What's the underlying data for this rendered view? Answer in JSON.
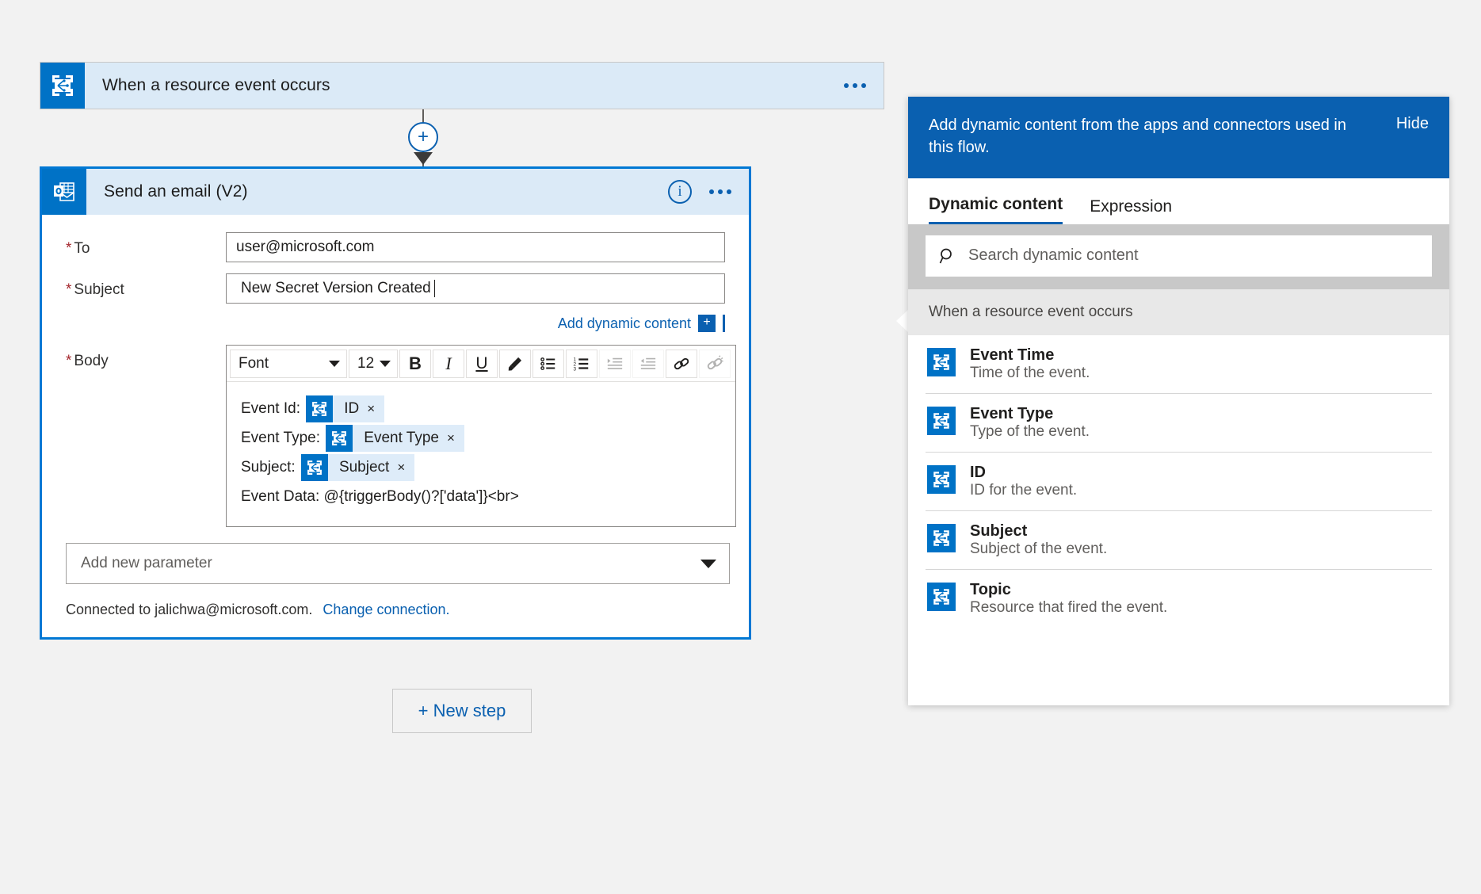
{
  "flow": {
    "trigger": {
      "title": "When a resource event occurs",
      "icon": "event-grid-icon",
      "more_label": "..."
    },
    "connector": {
      "add_label": "+"
    },
    "action": {
      "title": "Send an email (V2)",
      "icon": "outlook-icon",
      "info_label": "i",
      "more_label": "...",
      "fields": {
        "to": {
          "label": "To",
          "required": true,
          "value": "user@microsoft.com"
        },
        "subject": {
          "label": "Subject",
          "required": true,
          "value": "New Secret Version Created"
        },
        "body": {
          "label": "Body",
          "required": true
        }
      },
      "add_dynamic_content": {
        "link": "Add dynamic content",
        "plus": "+"
      },
      "editor": {
        "font_value": "Font",
        "size_value": "12",
        "buttons": [
          {
            "name": "bold-button",
            "glyph": "B"
          },
          {
            "name": "italic-button",
            "glyph": "I"
          },
          {
            "name": "underline-button",
            "glyph": "U"
          },
          {
            "name": "highlight-button",
            "glyph": "highlighter-icon"
          },
          {
            "name": "bullet-list-button",
            "glyph": "bullet-list-icon"
          },
          {
            "name": "numbered-list-button",
            "glyph": "numbered-list-icon"
          },
          {
            "name": "indent-button",
            "glyph": "indent-icon"
          },
          {
            "name": "outdent-button",
            "glyph": "outdent-icon"
          },
          {
            "name": "link-button",
            "glyph": "link-icon"
          },
          {
            "name": "unlink-button",
            "glyph": "unlink-icon"
          }
        ],
        "lines": [
          {
            "text": "Event Id: ",
            "token": "ID"
          },
          {
            "text": "Event Type: ",
            "token": "Event Type"
          },
          {
            "text": "Subject: ",
            "token": "Subject"
          },
          {
            "text": "Event Data: @{triggerBody()?['data']}<br>",
            "token": null
          }
        ],
        "token_remove_label": "×"
      },
      "add_parameter": "Add new parameter",
      "connection_text": "Connected to jalichwa@microsoft.com.",
      "change_connection": "Change connection."
    },
    "new_step": "+ New step"
  },
  "flyout": {
    "header_text": "Add dynamic content from the apps and connectors used in this flow.",
    "hide_label": "Hide",
    "tabs": [
      {
        "label": "Dynamic content",
        "active": true
      },
      {
        "label": "Expression",
        "active": false
      }
    ],
    "search": {
      "placeholder": "Search dynamic content",
      "value": ""
    },
    "group_title": "When a resource event occurs",
    "items": [
      {
        "name": "Event Time",
        "desc": "Time of the event.",
        "icon": "event-grid-icon"
      },
      {
        "name": "Event Type",
        "desc": "Type of the event.",
        "icon": "event-grid-icon"
      },
      {
        "name": "ID",
        "desc": "ID for the event.",
        "icon": "event-grid-icon"
      },
      {
        "name": "Subject",
        "desc": "Subject of the event.",
        "icon": "event-grid-icon"
      },
      {
        "name": "Topic",
        "desc": "Resource that fired the event.",
        "icon": "event-grid-icon"
      }
    ]
  },
  "colors": {
    "accent_blue": "#0a60b0",
    "icon_blue": "#0072c6",
    "card_blue": "#dbeaf7",
    "selected_border": "#0078d4",
    "required_red": "#a4262c",
    "page_bg": "#f2f2f2"
  }
}
